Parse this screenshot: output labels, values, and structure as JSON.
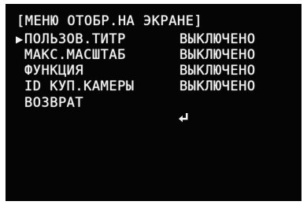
{
  "menu": {
    "title": "[МЕНЮ ОТОБР.НА ЭКРАНЕ]",
    "cursor_symbol": "▶",
    "items": [
      {
        "label": "ПОЛЬЗОВ.ТИТР",
        "value": "ВЫКЛЮЧЕНО",
        "selected": true
      },
      {
        "label": "МАКС.МАСШТАБ",
        "value": "ВЫКЛЮЧЕНО",
        "selected": false
      },
      {
        "label": "ФУНКЦИЯ",
        "value": "ВЫКЛЮЧЕНО",
        "selected": false
      },
      {
        "label": "ID КУП.КАМЕРЫ",
        "value": "ВЫКЛЮЧЕНО",
        "selected": false
      },
      {
        "label": "ВОЗВРАТ",
        "value_icon": "enter-return-icon",
        "selected": false
      }
    ]
  },
  "colors": {
    "background": "#050505",
    "text": "#f2f2f2"
  }
}
